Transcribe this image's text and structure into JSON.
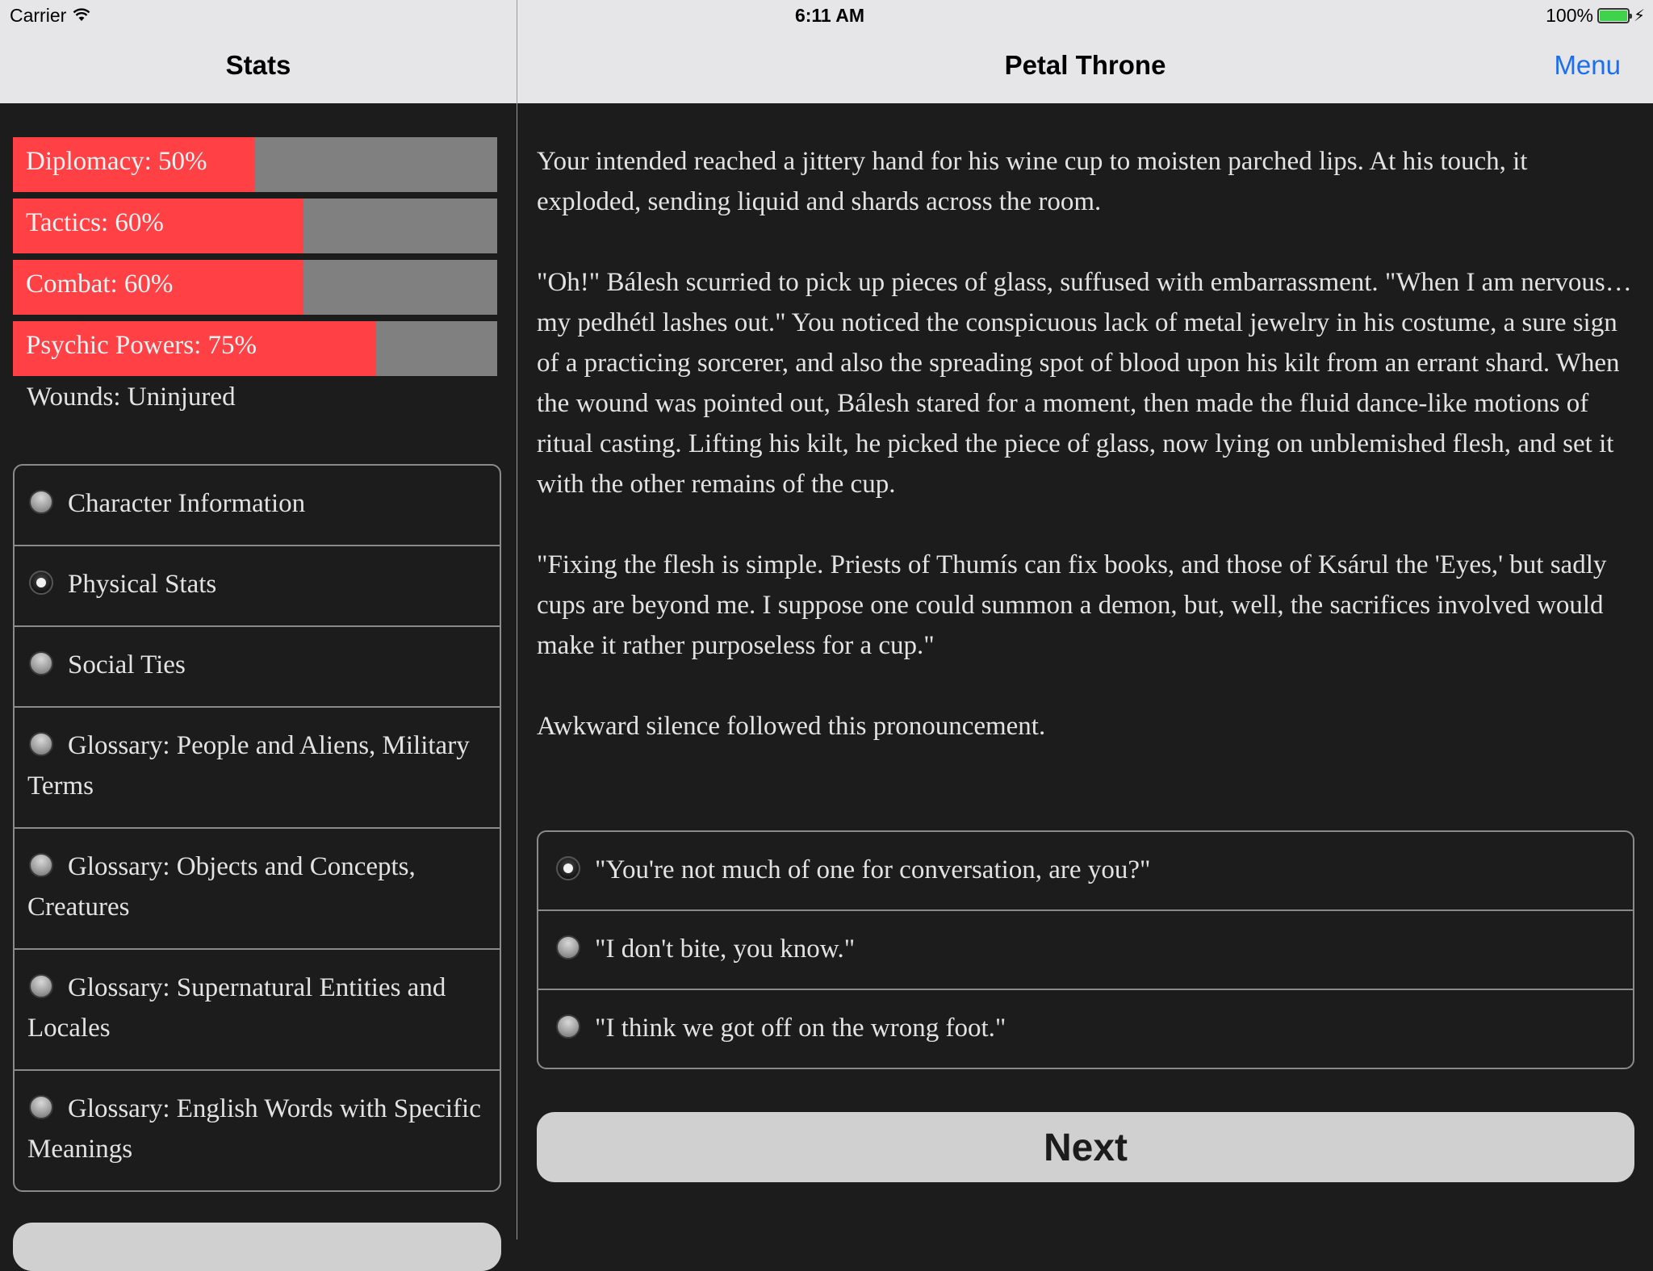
{
  "status_bar": {
    "carrier": "Carrier",
    "time": "6:11 AM",
    "battery_percent_label": "100%",
    "battery_level": 1.0,
    "battery_color": "#3fd24a",
    "charging": true
  },
  "left_nav": {
    "title": "Stats"
  },
  "right_nav": {
    "title": "Petal Throne",
    "menu_label": "Menu",
    "menu_color": "#1b6ef0"
  },
  "stats": {
    "bar_color": "#ff4145",
    "track_color": "#808080",
    "items": [
      {
        "label": "Diplomacy: 50%",
        "value": 50
      },
      {
        "label": "Tactics: 60%",
        "value": 60
      },
      {
        "label": "Combat: 60%",
        "value": 60
      },
      {
        "label": "Psychic Powers: 75%",
        "value": 75
      }
    ],
    "wounds": "Wounds: Uninjured"
  },
  "sections": {
    "selected_index": 1,
    "items": [
      {
        "label": "Character Information",
        "selected": false
      },
      {
        "label": "Physical Stats",
        "selected": true
      },
      {
        "label": "Social Ties",
        "selected": false
      },
      {
        "label": "Glossary: People and Aliens, Military Terms",
        "selected": false
      },
      {
        "label": "Glossary: Objects and Concepts, Creatures",
        "selected": false
      },
      {
        "label": "Glossary: Supernatural Entities and Locales",
        "selected": false
      },
      {
        "label": "Glossary: English Words with Specific Meanings",
        "selected": false
      }
    ]
  },
  "story": {
    "paragraphs": [
      "Your intended reached a jittery hand for his wine cup to moisten parched lips. At his touch, it exploded, sending liquid and shards across the room.",
      "\"Oh!\" Bálesh scurried to pick up pieces of glass, suffused with embarrassment. \"When I am nervous…my pedhétl lashes out.\" You noticed the conspicuous lack of metal jewelry in his costume, a sure sign of a practicing sorcerer, and also the spreading spot of blood upon his kilt from an errant shard. When the wound was pointed out, Bálesh stared for a moment, then made the fluid dance-like motions of ritual casting. Lifting his kilt, he picked the piece of glass, now lying on unblemished flesh, and set it with the other remains of the cup.",
      "\"Fixing the flesh is simple. Priests of Thumís can fix books, and those of Ksárul the 'Eyes,' but sadly cups are beyond me. I suppose one could summon a demon, but, well, the sacrifices involved would make it rather purposeless for a cup.\"",
      "Awkward silence followed this pronouncement."
    ]
  },
  "choices": {
    "selected_index": 0,
    "items": [
      {
        "label": "\"You're not much of one for conversation, are you?\"",
        "selected": true
      },
      {
        "label": "\"I don't bite, you know.\"",
        "selected": false
      },
      {
        "label": "\"I think we got off on the wrong foot.\"",
        "selected": false
      }
    ]
  },
  "next_button": {
    "label": "Next"
  }
}
